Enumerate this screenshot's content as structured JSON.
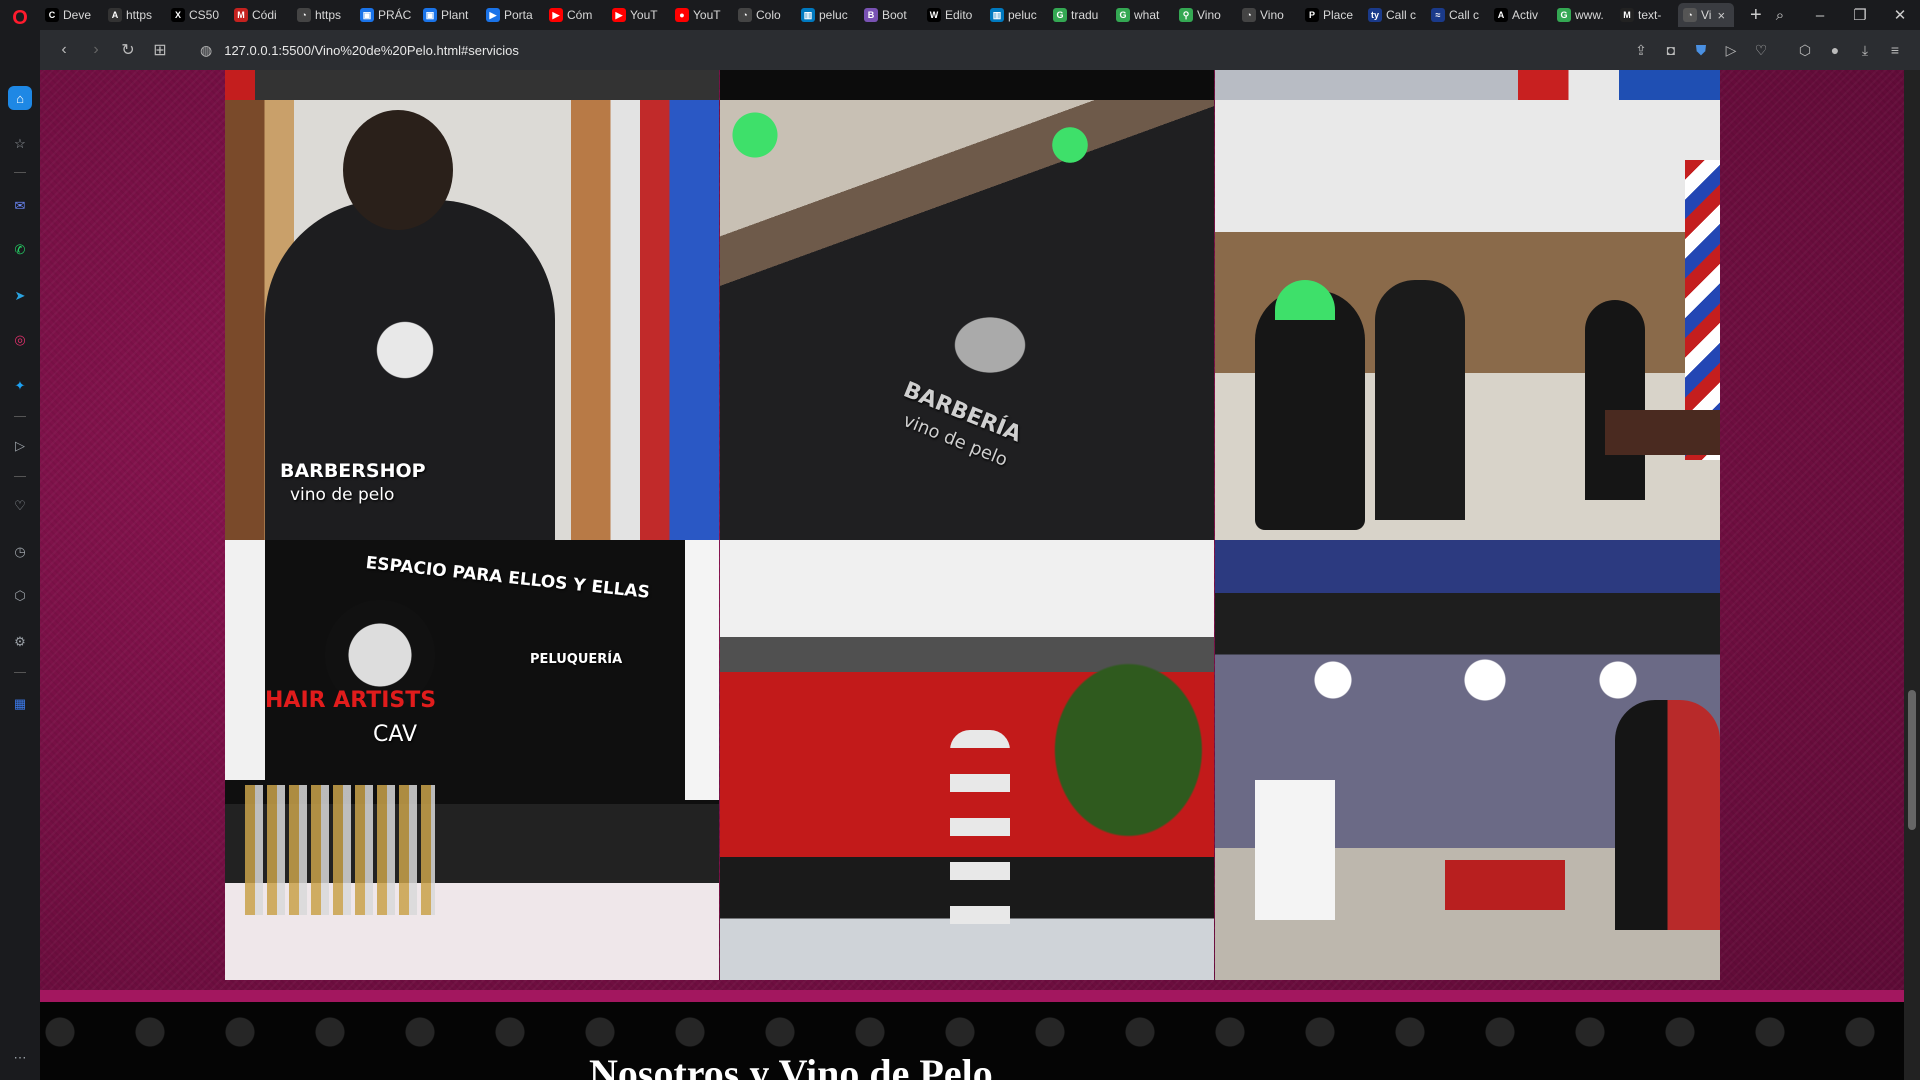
{
  "browser": {
    "tabs": [
      {
        "label": "Deve",
        "color": "#000000",
        "glyph": "C"
      },
      {
        "label": "https",
        "color": "#333333",
        "glyph": "A"
      },
      {
        "label": "CS50",
        "color": "#000000",
        "glyph": "X"
      },
      {
        "label": "Códi",
        "color": "#c5221f",
        "glyph": "M"
      },
      {
        "label": "https",
        "color": "#444444",
        "glyph": "◔"
      },
      {
        "label": "PRÁC",
        "color": "#1a73e8",
        "glyph": "▣"
      },
      {
        "label": "Plant",
        "color": "#1a73e8",
        "glyph": "▣"
      },
      {
        "label": "Porta",
        "color": "#1a73e8",
        "glyph": "▶"
      },
      {
        "label": "Cóm",
        "color": "#ff0000",
        "glyph": "▶"
      },
      {
        "label": "YouT",
        "color": "#ff0000",
        "glyph": "▶"
      },
      {
        "label": "YouT",
        "color": "#ff0000",
        "glyph": "●"
      },
      {
        "label": "Colo",
        "color": "#444444",
        "glyph": "◔"
      },
      {
        "label": "peluc",
        "color": "#0079bf",
        "glyph": "▥"
      },
      {
        "label": "Boot",
        "color": "#7952b3",
        "glyph": "B"
      },
      {
        "label": "Edito",
        "color": "#000000",
        "glyph": "W"
      },
      {
        "label": "peluc",
        "color": "#0079bf",
        "glyph": "▥"
      },
      {
        "label": "tradu",
        "color": "#34a853",
        "glyph": "G"
      },
      {
        "label": "what",
        "color": "#34a853",
        "glyph": "G"
      },
      {
        "label": "Vino",
        "color": "#34a853",
        "glyph": "⚲"
      },
      {
        "label": "Vino",
        "color": "#444444",
        "glyph": "◔"
      },
      {
        "label": "Place",
        "color": "#000000",
        "glyph": "P"
      },
      {
        "label": "Call c",
        "color": "#1a3a8a",
        "glyph": "ty"
      },
      {
        "label": "Call c",
        "color": "#1a3a8a",
        "glyph": "≈"
      },
      {
        "label": "Activ",
        "color": "#000000",
        "glyph": "A"
      },
      {
        "label": "www.",
        "color": "#34a853",
        "glyph": "G"
      },
      {
        "label": "text-",
        "color": "#222222",
        "glyph": "M"
      }
    ],
    "active_tab": {
      "label": "Vi",
      "close": "×"
    },
    "new_tab": "+",
    "window_controls": {
      "search": "⌕",
      "minimize": "–",
      "restore": "❐",
      "close": "✕"
    },
    "url": "127.0.0.1:5500/Vino%20de%20Pelo.html#servicios"
  },
  "page": {
    "photos_top": [
      {
        "caption": "BARBERSHOP",
        "sub": "vino de pelo",
        "theme": "#3b2a22"
      },
      {
        "caption": "BARBERÍA",
        "sub": "vino de pelo",
        "theme": "#2a2a2a"
      },
      {
        "caption": "",
        "sub": "",
        "theme": "#cfc8bc"
      }
    ],
    "photos_bottom": [
      {
        "caption": "ESPACIO PARA ELLOS Y ELLAS",
        "sub": "HAIR ARTISTS",
        "extra": "PELUQUERÍA",
        "extra2": "CAV",
        "theme": "#111111"
      },
      {
        "caption": "",
        "sub": "",
        "theme": "#b01818"
      },
      {
        "caption": "",
        "sub": "",
        "theme": "#4a4660"
      }
    ],
    "section_title": "Nosotros y Vino de Pelo"
  }
}
